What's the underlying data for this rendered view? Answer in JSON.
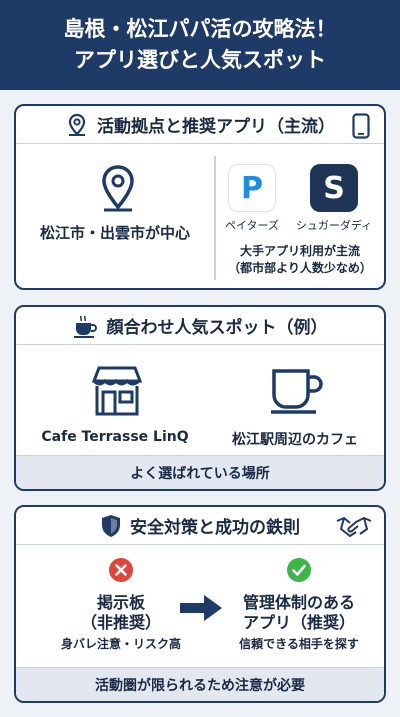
{
  "header": {
    "line1": "島根・松江パパ活の攻略法！",
    "line2": "アプリ選びと人気スポット"
  },
  "section1": {
    "title": "活動拠点と推奨アプリ（主流）",
    "location": "松江市・出雲市が中心",
    "apps": [
      {
        "name": "ペイターズ",
        "glyph": "P"
      },
      {
        "name": "シュガーダディ",
        "glyph": "S"
      }
    ],
    "note_line1": "大手アプリ利用が主流",
    "note_line2": "（都市部より人数少なめ）"
  },
  "section2": {
    "title": "顔合わせ人気スポット（例）",
    "spot1": "Cafe Terrasse LinQ",
    "spot2": "松江駅周辺のカフェ",
    "footer": "よく選ばれている場所"
  },
  "section3": {
    "title": "安全対策と成功の鉄則",
    "left_line1": "掲示板",
    "left_line2": "（非推奨）",
    "left_sub": "身バレ注意・リスク高",
    "right_line1": "管理体制のある",
    "right_line2": "アプリ（推奨）",
    "right_sub": "信頼できる相手を探す",
    "footer": "活動圏が限られるため注意が必要"
  },
  "colors": {
    "navy": "#1e3a66",
    "paters_blue": "#1a8fe3",
    "sugar_navy": "#1f3558",
    "danger_red": "#e0443a",
    "ok_green": "#3db548"
  }
}
